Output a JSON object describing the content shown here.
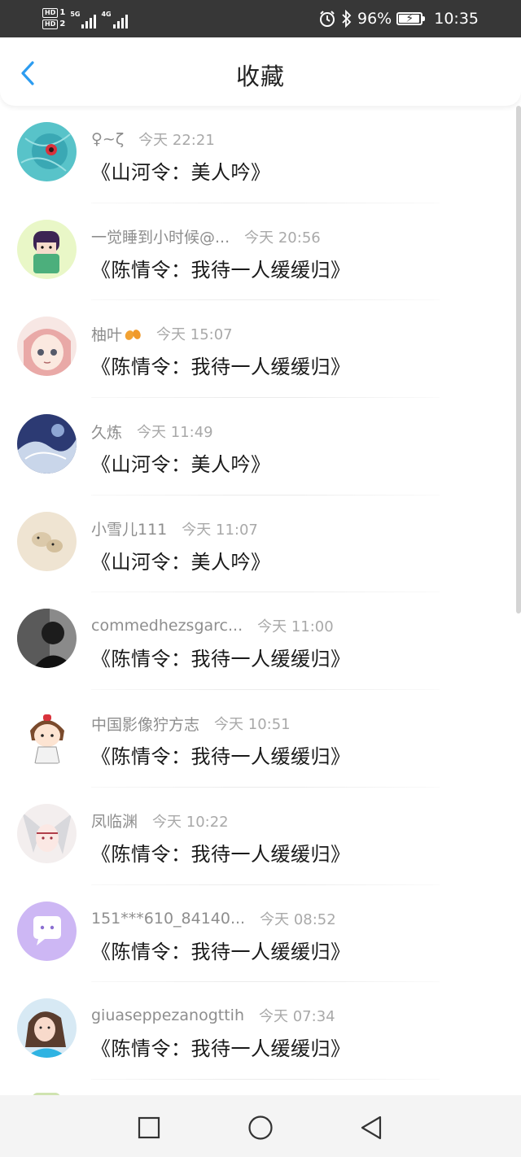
{
  "status_bar": {
    "hd1": "HD",
    "hd1_num": "1",
    "hd2": "HD",
    "hd2_num": "2",
    "net1": "5G",
    "net2": "4G",
    "battery_percent": "96%",
    "battery_level": 0.96,
    "time": "10:35"
  },
  "header": {
    "title": "收藏",
    "back_icon": "chevron-left-icon",
    "accent_color": "#2c9cf0"
  },
  "items": [
    {
      "name": "♀~ζ",
      "time": "今天 22:21",
      "title": "《山河令：美人吟》",
      "avatar": "teal-abstract"
    },
    {
      "name": "一觉睡到小时候@...",
      "time": "今天 20:56",
      "title": "《陈情令：我待一人缓缓归》",
      "avatar": "anime-boy-green"
    },
    {
      "name": "柚叶",
      "time": "今天 15:07",
      "title": "《陈情令：我待一人缓缓归》",
      "avatar": "anime-girl-pink",
      "name_icon": "leaf-icon"
    },
    {
      "name": "久炼",
      "time": "今天 11:49",
      "title": "《山河令：美人吟》",
      "avatar": "blue-art"
    },
    {
      "name": "小雪儿111",
      "time": "今天 11:07",
      "title": "《山河令：美人吟》",
      "avatar": "beige-photo"
    },
    {
      "name": "commedhezsgarc...",
      "time": "今天 11:00",
      "title": "《陈情令：我待一人缓缓归》",
      "avatar": "dark-silhouette"
    },
    {
      "name": "中国影像狞方志",
      "time": "今天 10:51",
      "title": "《陈情令：我待一人缓缓归》",
      "avatar": "cartoon-girl"
    },
    {
      "name": "凤临渊",
      "time": "今天 10:22",
      "title": "《陈情令：我待一人缓缓归》",
      "avatar": "white-hair-anime"
    },
    {
      "name": "151***610_84140...",
      "time": "今天 08:52",
      "title": "《陈情令：我待一人缓缓归》",
      "avatar": "default-chat-purple"
    },
    {
      "name": "giuaseppezanogttih",
      "time": "今天 07:34",
      "title": "《陈情令：我待一人缓缓归》",
      "avatar": "girl-photo"
    }
  ],
  "nav": {
    "recent_icon": "square-icon",
    "home_icon": "circle-icon",
    "back_icon": "triangle-back-icon"
  }
}
